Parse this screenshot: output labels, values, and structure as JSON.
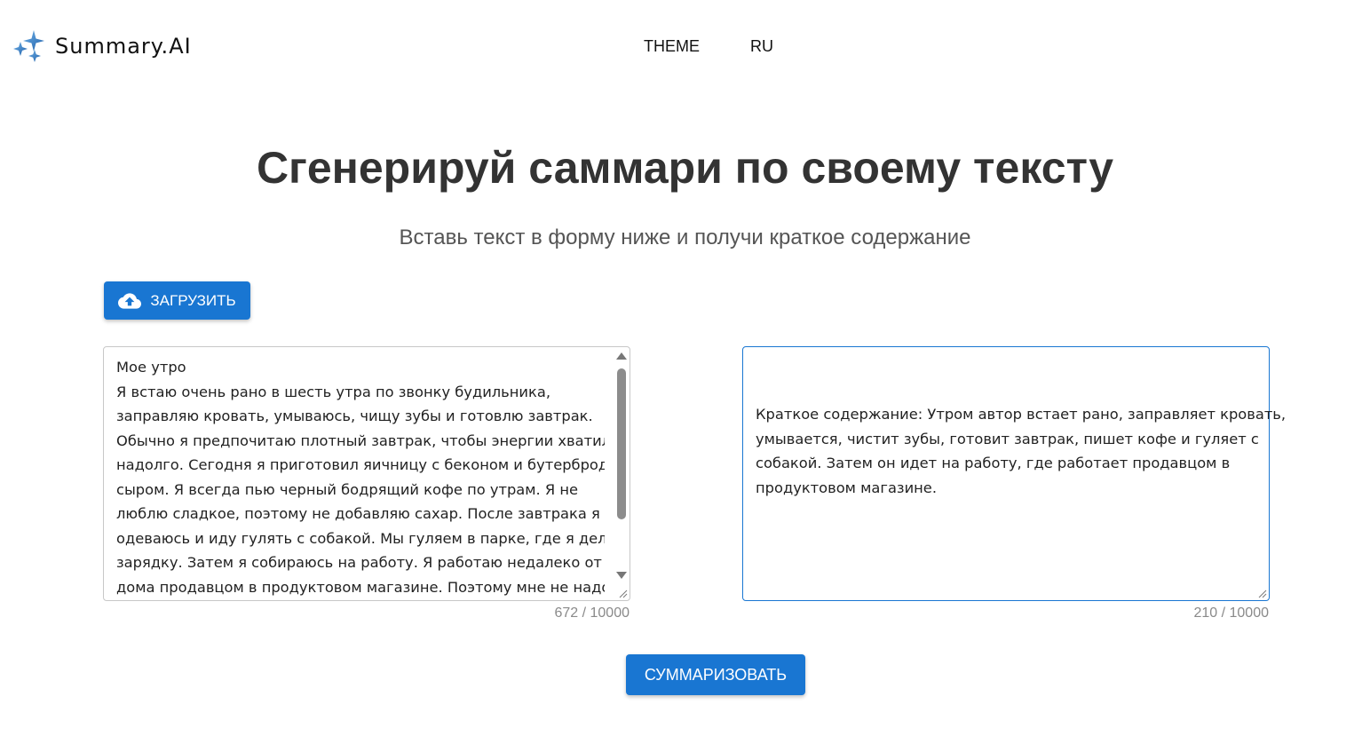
{
  "header": {
    "logo_text": "Summary.AI",
    "logo_icon": "sparkle-icon",
    "nav": [
      {
        "label": "THEME"
      },
      {
        "label": "RU"
      }
    ]
  },
  "main": {
    "title": "Сгенерируй саммари по своему тексту",
    "subtitle": "Вставь текст в форму ниже и получи краткое содержание",
    "upload_button": {
      "label": "ЗАГРУЗИТЬ",
      "icon": "cloud-upload-icon"
    },
    "input": {
      "lines": [
        "Мое утро",
        "Я встаю очень рано в шесть утра по звонку будильника,",
        "заправляю кровать, умываюсь, чищу зубы и готовлю завтрак.",
        "Обычно я предпочитаю плотный завтрак, чтобы энергии хватило",
        "надолго. Сегодня я приготовил яичницу с беконом и бутерброд с",
        "сыром. Я всегда пью черный бодрящий кофе по утрам. Я не",
        "люблю сладкое, поэтому не добавляю сахар. После завтрака я",
        "одеваюсь и иду гулять с собакой. Мы гуляем в парке, где я делаю",
        "зарядку. Затем я собираюсь на работу. Я работаю недалеко от",
        "дома продавцом в продуктовом магазине. Поэтому мне не надо"
      ],
      "counter": "672 / 10000"
    },
    "output": {
      "lines": [
        "Краткое содержание: Утром автор встает рано, заправляет кровать,",
        "умывается, чистит зубы, готовит завтрак, пишет кофе и гуляет с",
        "собакой. Затем он идет на работу, где работает продавцом в",
        "продуктовом магазине."
      ],
      "counter": "210 / 10000"
    },
    "summarize_button": {
      "label": "СУММАРИЗОВАТЬ"
    }
  },
  "colors": {
    "primary": "#1976d2",
    "title": "#333333",
    "subtitle": "#555555",
    "counter": "#8a8a8a"
  }
}
